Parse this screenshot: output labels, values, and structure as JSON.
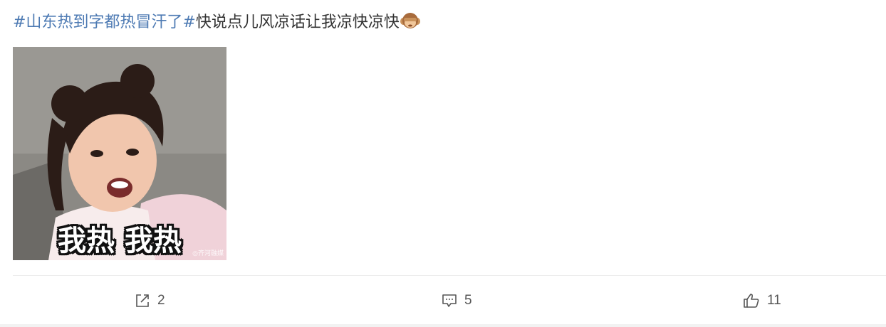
{
  "post": {
    "topic": "#山东热到字都热冒汗了#",
    "body": "快说点儿风凉话让我凉快凉快",
    "emoji": "monkey-see-no-evil-icon"
  },
  "image": {
    "caption": "我热 我热",
    "watermark": "◎齐河融媒"
  },
  "actions": {
    "repost_count": "2",
    "comment_count": "5",
    "like_count": "11"
  },
  "colors": {
    "topic": "#4d7ab3",
    "text": "#333333",
    "icon": "#555555"
  }
}
